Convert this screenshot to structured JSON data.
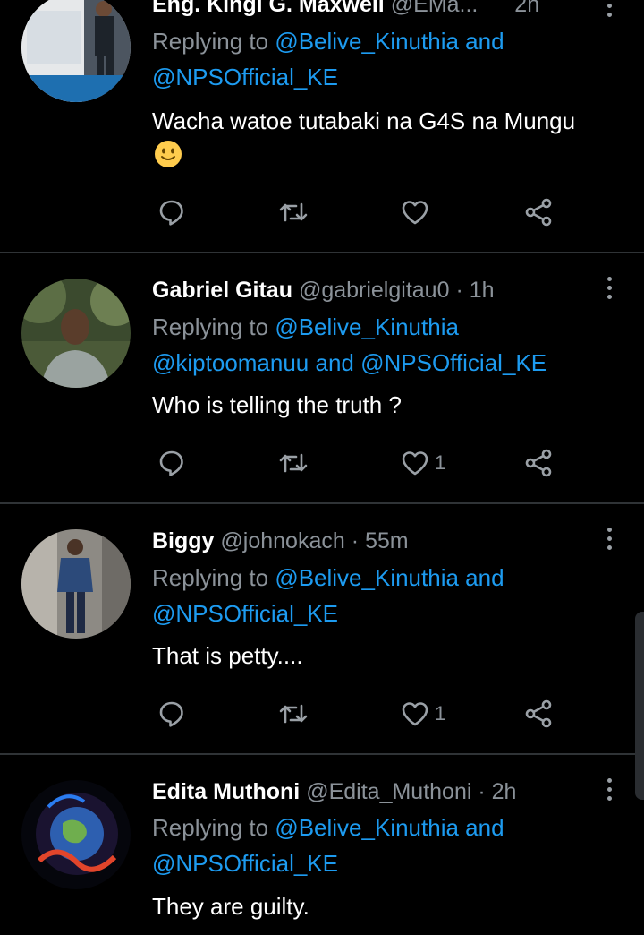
{
  "tweets": [
    {
      "name": "Eng. Kingi G. Maxwell",
      "handle": "@EMa...",
      "time": "2h",
      "reply_prefix": "Replying to",
      "mentions_line1": "@Belive_Kinuthia and",
      "mentions_line2": "@NPSOfficial_KE",
      "text": "Wacha watoe tutabaki na G4S na Mungu",
      "emoji": "slightly-smiling-face",
      "likes": ""
    },
    {
      "name": "Gabriel Gitau",
      "handle": "@gabrielgitau0",
      "time": "· 1h",
      "reply_prefix": "Replying to",
      "mentions_line1": "@Belive_Kinuthia",
      "mentions_line2": "@kiptoomanuu and @NPSOfficial_KE",
      "text": "Who is telling the truth ?",
      "likes": "1"
    },
    {
      "name": "Biggy",
      "handle": "@johnokach",
      "time": "· 55m",
      "reply_prefix": "Replying to",
      "mentions_line1": "@Belive_Kinuthia and",
      "mentions_line2": "@NPSOfficial_KE",
      "text": "That is petty....",
      "likes": "1"
    },
    {
      "name": "Edita Muthoni",
      "handle": "@Edita_Muthoni",
      "time": "· 2h",
      "reply_prefix": "Replying to",
      "mentions_line1": "@Belive_Kinuthia and",
      "mentions_line2": "@NPSOfficial_KE",
      "text": "They are guilty."
    }
  ],
  "icons": {
    "reply": "reply-icon",
    "retweet": "retweet-icon",
    "like": "heart-icon",
    "share": "share-icon",
    "more": "more-icon"
  },
  "colors": {
    "background": "#000000",
    "mention": "#1d9bf0",
    "muted": "#8b9299",
    "divider": "#2f3336"
  }
}
